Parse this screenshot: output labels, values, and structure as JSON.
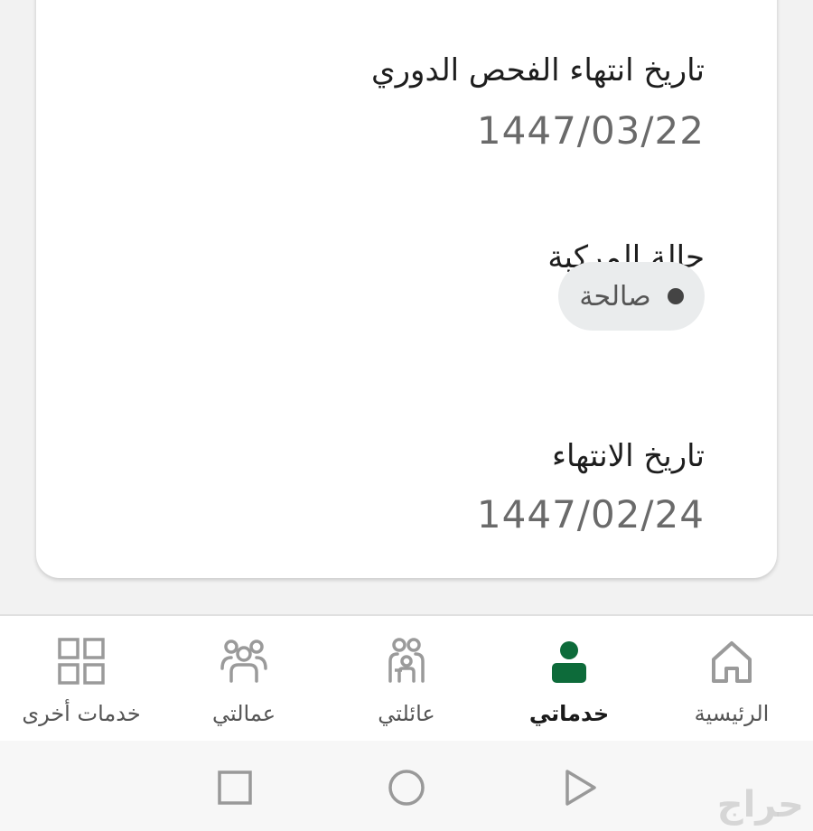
{
  "card": {
    "inspection_label": "تاريخ انتهاء الفحص الدوري",
    "inspection_value": "1447/03/22",
    "status_label": "حالة المركبة",
    "status_value": "صالحة",
    "expiry_label": "تاريخ الانتهاء",
    "expiry_value": "1447/02/24"
  },
  "nav": {
    "home": "الرئيسية",
    "services": "خدماتي",
    "family": "عائلتي",
    "workers": "عمالتي",
    "other": "خدمات أخرى"
  },
  "colors": {
    "active": "#0d6b3a",
    "icon": "#9a9a9a"
  },
  "icons": [
    "home-icon",
    "person-icon",
    "family-icon",
    "workers-icon",
    "grid-icon"
  ],
  "watermark": "حراج"
}
